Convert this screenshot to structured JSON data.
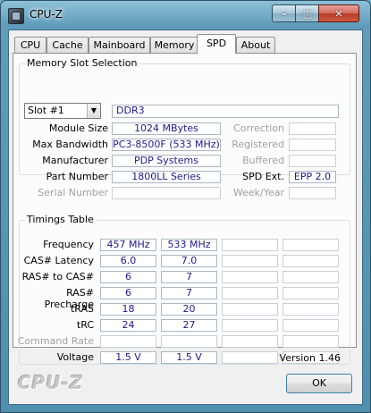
{
  "window": {
    "title": "CPU-Z"
  },
  "tabs": [
    "CPU",
    "Cache",
    "Mainboard",
    "Memory",
    "SPD",
    "About"
  ],
  "memory_slot": {
    "group_title": "Memory Slot Selection",
    "slot_selected": "Slot #1",
    "memory_type": "DDR3",
    "rows": [
      {
        "label": "Module Size",
        "value": "1024 MBytes",
        "right_label": "Correction",
        "right_value": ""
      },
      {
        "label": "Max Bandwidth",
        "value": "PC3-8500F (533 MHz)",
        "right_label": "Registered",
        "right_value": ""
      },
      {
        "label": "Manufacturer",
        "value": "PDP Systems",
        "right_label": "Buffered",
        "right_value": ""
      },
      {
        "label": "Part Number",
        "value": "1800LL Series",
        "right_label": "SPD Ext.",
        "right_value": "EPP 2.0"
      },
      {
        "label": "Serial Number",
        "value": "",
        "right_label": "Week/Year",
        "right_value": ""
      }
    ]
  },
  "timings": {
    "group_title": "Timings Table",
    "rows": [
      {
        "label": "Frequency",
        "values": [
          "457 MHz",
          "533 MHz",
          "",
          ""
        ]
      },
      {
        "label": "CAS# Latency",
        "values": [
          "6.0",
          "7.0",
          "",
          ""
        ]
      },
      {
        "label": "RAS# to CAS#",
        "values": [
          "6",
          "7",
          "",
          ""
        ]
      },
      {
        "label": "RAS# Precharge",
        "values": [
          "6",
          "7",
          "",
          ""
        ]
      },
      {
        "label": "tRAS",
        "values": [
          "18",
          "20",
          "",
          ""
        ]
      },
      {
        "label": "tRC",
        "values": [
          "24",
          "27",
          "",
          ""
        ]
      },
      {
        "label": "Command Rate",
        "values": [
          "",
          "",
          "",
          ""
        ]
      },
      {
        "label": "Voltage",
        "values": [
          "1.5 V",
          "1.5 V",
          "",
          ""
        ]
      }
    ]
  },
  "footer": {
    "version": "Version 1.46",
    "logo": "CPU-Z",
    "ok_label": "OK"
  }
}
